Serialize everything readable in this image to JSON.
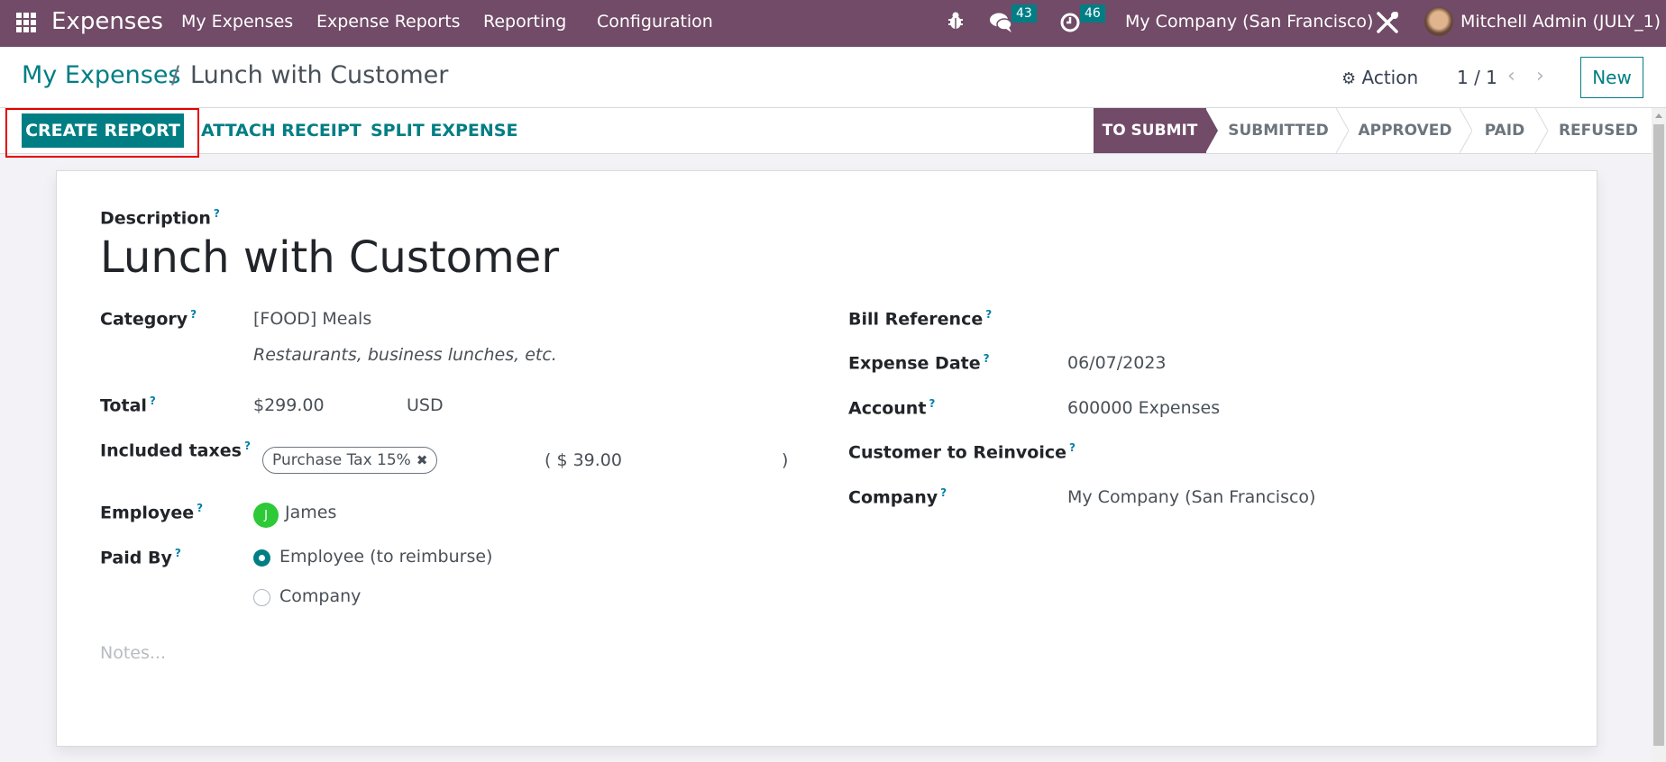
{
  "navbar": {
    "app_name": "Expenses",
    "menu": [
      "My Expenses",
      "Expense Reports",
      "Reporting",
      "Configuration"
    ],
    "messages_count": "43",
    "activities_count": "46",
    "company": "My Company (San Francisco)",
    "user": "Mitchell Admin (JULY_1)"
  },
  "control": {
    "breadcrumb_parent": "My Expenses",
    "breadcrumb_separator": "/",
    "breadcrumb_current": "Lunch with Customer",
    "action_label": "Action",
    "pager": "1 / 1",
    "new_label": "New"
  },
  "statusbar": {
    "buttons": [
      "CREATE REPORT",
      "ATTACH RECEIPT",
      "SPLIT EXPENSE"
    ],
    "stages": [
      "TO SUBMIT",
      "SUBMITTED",
      "APPROVED",
      "PAID",
      "REFUSED"
    ],
    "active_stage": "TO SUBMIT",
    "accent_color": "#714b67"
  },
  "form": {
    "description_label": "Description",
    "description": "Lunch with Customer",
    "help_marker": "?",
    "left": {
      "category_label": "Category",
      "category": "[FOOD] Meals",
      "category_note": "Restaurants, business lunches, etc.",
      "total_label": "Total",
      "total": "$299.00",
      "currency": "USD",
      "taxes_label": "Included taxes",
      "tax_tag": "Purchase Tax 15%",
      "tax_amount_open": "( $ 39.00",
      "tax_amount_close": ")",
      "employee_label": "Employee",
      "employee_initial": "J",
      "employee": "James",
      "paid_by_label": "Paid By",
      "paid_by_options": [
        "Employee (to reimburse)",
        "Company"
      ],
      "paid_by_selected": "Employee (to reimburse)"
    },
    "right": {
      "bill_ref_label": "Bill Reference",
      "bill_ref": "",
      "date_label": "Expense Date",
      "date": "06/07/2023",
      "account_label": "Account",
      "account": "600000 Expenses",
      "customer_label": "Customer to Reinvoice",
      "customer": "",
      "company_label": "Company",
      "company": "My Company (San Francisco)"
    },
    "notes_placeholder": "Notes..."
  }
}
